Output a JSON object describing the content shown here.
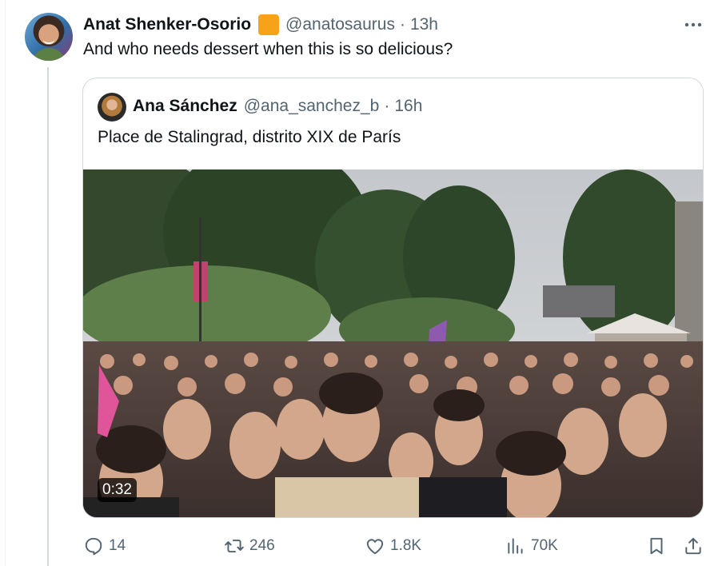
{
  "tweet": {
    "author_name": "Anat Shenker-Osorio",
    "handle": "@anatosaurus",
    "separator": "·",
    "time": "13h",
    "text": "And who needs dessert when this is so delicious?",
    "badge_color": "#f6a31a",
    "more_icon": "ellipsis-icon"
  },
  "quote": {
    "author_name": "Ana Sánchez",
    "handle": "@ana_sanchez_b",
    "separator": "·",
    "time": "16h",
    "text": "Place de Stalingrad, distrito XIX de París",
    "video_duration": "0:32"
  },
  "actions": {
    "replies": {
      "icon": "reply-icon",
      "count": "14"
    },
    "reposts": {
      "icon": "repost-icon",
      "count": "246"
    },
    "likes": {
      "icon": "heart-icon",
      "count": "1.8K"
    },
    "views": {
      "icon": "views-icon",
      "count": "70K"
    },
    "bookmark": {
      "icon": "bookmark-icon"
    },
    "share": {
      "icon": "share-icon"
    }
  }
}
